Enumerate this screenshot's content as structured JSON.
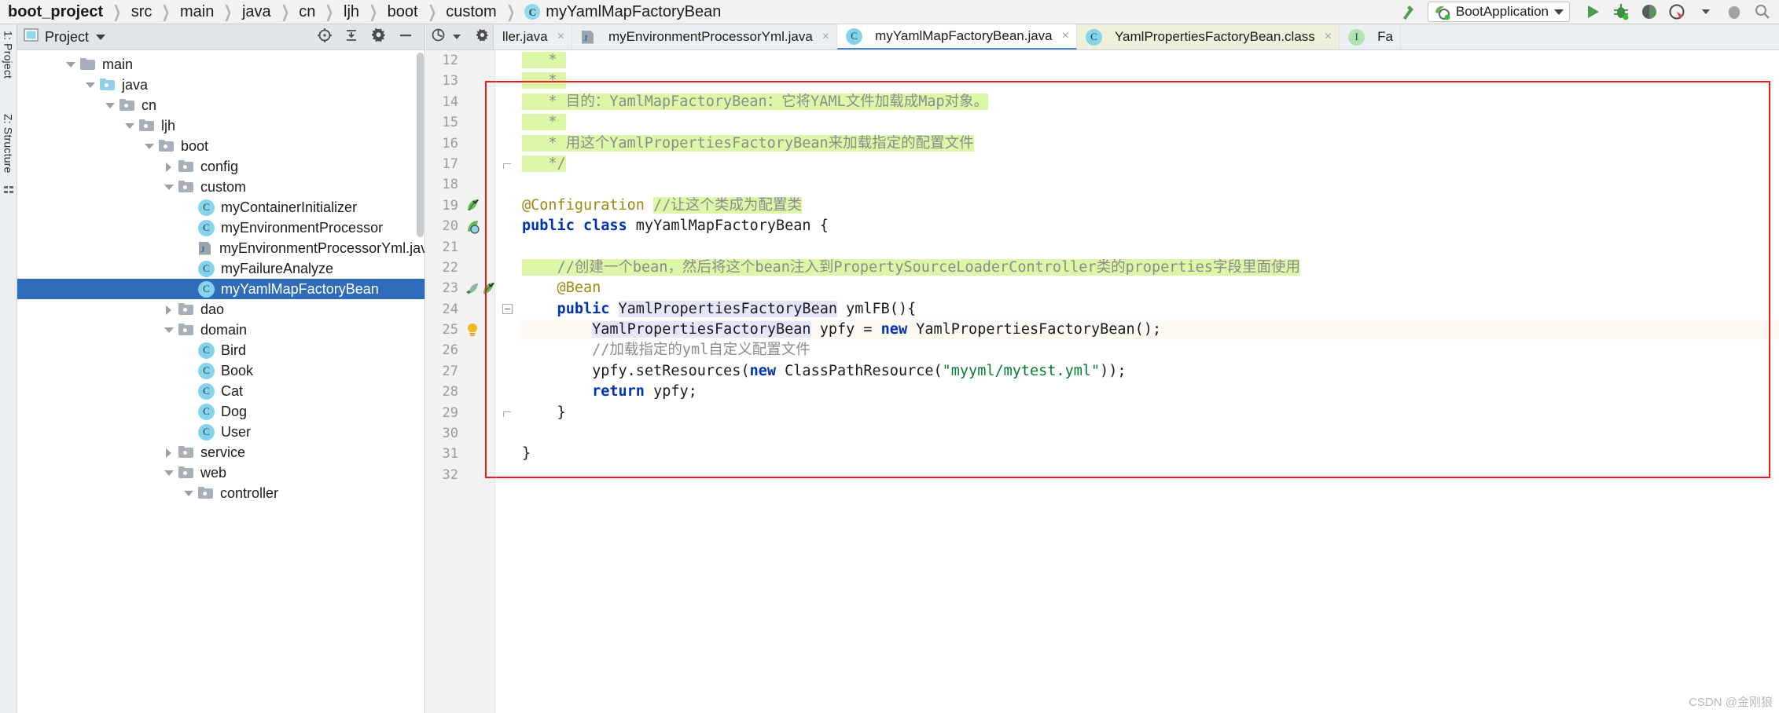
{
  "window": {
    "app": "IntelliJ IDEA",
    "file": "myYamlMapFactoryBean.java"
  },
  "breadcrumb": {
    "items": [
      {
        "label": "boot_project",
        "kind": "project"
      },
      {
        "label": "src",
        "kind": "folder"
      },
      {
        "label": "main",
        "kind": "folder"
      },
      {
        "label": "java",
        "kind": "folder"
      },
      {
        "label": "cn",
        "kind": "package"
      },
      {
        "label": "ljh",
        "kind": "package"
      },
      {
        "label": "boot",
        "kind": "package"
      },
      {
        "label": "custom",
        "kind": "package"
      },
      {
        "label": "myYamlMapFactoryBean",
        "kind": "class",
        "icon": "class-icon",
        "icon_letter": "C"
      }
    ],
    "separator": "❯"
  },
  "toolbar": {
    "build_label": "build-hammer-icon",
    "run_config": {
      "name": "BootApplication",
      "icon": "spring-boot-icon",
      "dropdown": "▼"
    },
    "buttons": [
      {
        "name": "run-button",
        "icon": "play-icon",
        "color": "#4a9a4a"
      },
      {
        "name": "debug-button",
        "icon": "bug-icon",
        "color": "#3e8e41"
      },
      {
        "name": "run-with-coverage-button",
        "icon": "coverage-icon",
        "color": "#3c6b3c"
      },
      {
        "name": "profiler-button",
        "icon": "profiler-icon",
        "color": "#d64c4c"
      },
      {
        "name": "stop-button",
        "icon": "stop-icon",
        "color": "#9a9a9a"
      }
    ]
  },
  "tool_strips": {
    "left": [
      {
        "label": "1: Project",
        "name": "tool-window-project"
      },
      {
        "label": "Z: Structure",
        "name": "tool-window-structure"
      }
    ]
  },
  "project_panel": {
    "title": "Project",
    "dropdown": "▾",
    "header_icons": [
      {
        "name": "locate-file-icon",
        "glyph": "⊕"
      },
      {
        "name": "collapse-all-icon",
        "glyph": "⤓"
      },
      {
        "name": "settings-gear-icon",
        "glyph": "⚙"
      },
      {
        "name": "hide-panel-icon",
        "glyph": "—"
      }
    ],
    "tree": [
      {
        "label": "main",
        "indent": 2,
        "arrow": "down",
        "icon": "folder-icon",
        "selected": false
      },
      {
        "label": "java",
        "indent": 3,
        "arrow": "down",
        "icon": "source-folder-icon",
        "selected": false
      },
      {
        "label": "cn",
        "indent": 4,
        "arrow": "down",
        "icon": "package-icon",
        "selected": false
      },
      {
        "label": "ljh",
        "indent": 5,
        "arrow": "down",
        "icon": "package-icon",
        "selected": false
      },
      {
        "label": "boot",
        "indent": 6,
        "arrow": "down",
        "icon": "package-icon",
        "selected": false
      },
      {
        "label": "config",
        "indent": 7,
        "arrow": "right",
        "icon": "package-icon",
        "selected": false
      },
      {
        "label": "custom",
        "indent": 7,
        "arrow": "down",
        "icon": "package-icon",
        "selected": false
      },
      {
        "label": "myContainerInitializer",
        "indent": 8,
        "arrow": "none",
        "icon": "java-class-icon",
        "selected": false
      },
      {
        "label": "myEnvironmentProcessor",
        "indent": 8,
        "arrow": "none",
        "icon": "java-class-icon",
        "selected": false
      },
      {
        "label": "myEnvironmentProcessorYml.java",
        "indent": 8,
        "arrow": "none",
        "icon": "java-file-icon",
        "selected": false
      },
      {
        "label": "myFailureAnalyze",
        "indent": 8,
        "arrow": "none",
        "icon": "java-class-icon",
        "selected": false
      },
      {
        "label": "myYamlMapFactoryBean",
        "indent": 8,
        "arrow": "none",
        "icon": "java-class-icon",
        "selected": true
      },
      {
        "label": "dao",
        "indent": 7,
        "arrow": "right",
        "icon": "package-icon",
        "selected": false
      },
      {
        "label": "domain",
        "indent": 7,
        "arrow": "down",
        "icon": "package-icon",
        "selected": false
      },
      {
        "label": "Bird",
        "indent": 8,
        "arrow": "none",
        "icon": "java-class-icon",
        "selected": false
      },
      {
        "label": "Book",
        "indent": 8,
        "arrow": "none",
        "icon": "java-class-icon",
        "selected": false
      },
      {
        "label": "Cat",
        "indent": 8,
        "arrow": "none",
        "icon": "java-class-icon",
        "selected": false
      },
      {
        "label": "Dog",
        "indent": 8,
        "arrow": "none",
        "icon": "java-class-icon",
        "selected": false
      },
      {
        "label": "User",
        "indent": 8,
        "arrow": "none",
        "icon": "java-class-icon",
        "selected": false
      },
      {
        "label": "service",
        "indent": 7,
        "arrow": "right",
        "icon": "package-icon",
        "selected": false
      },
      {
        "label": "web",
        "indent": 7,
        "arrow": "down",
        "icon": "package-icon",
        "selected": false
      },
      {
        "label": "controller",
        "indent": 8,
        "arrow": "down",
        "icon": "package-icon",
        "selected": false
      }
    ]
  },
  "editor": {
    "tab_tools": [
      {
        "name": "previous-occurrence-icon",
        "glyph": "ⓛ"
      },
      {
        "name": "collapse-lines-icon",
        "glyph": "↧"
      },
      {
        "name": "tab-settings-icon",
        "glyph": "⚙"
      },
      {
        "name": "hide-editor-icon",
        "glyph": "—"
      }
    ],
    "tabs": [
      {
        "label": "ller.java",
        "icon": "java-class-icon",
        "active": false,
        "kind": "truncated",
        "closable": true
      },
      {
        "label": "myEnvironmentProcessorYml.java",
        "icon": "java-file-icon",
        "active": false,
        "kind": "java",
        "closable": true
      },
      {
        "label": "myYamlMapFactoryBean.java",
        "icon": "java-class-icon",
        "active": true,
        "kind": "java",
        "closable": true
      },
      {
        "label": "YamlPropertiesFactoryBean.class",
        "icon": "java-class-icon",
        "active": false,
        "kind": "class",
        "closable": true
      },
      {
        "label": "Fa",
        "icon": "interface-icon",
        "active": false,
        "kind": "truncated",
        "closable": false
      }
    ],
    "first_line": 12,
    "lines": [
      {
        "n": 12,
        "gutter": [],
        "fold": "none",
        "caret": false,
        "segments": [
          {
            "text": "   * ",
            "cls": "cmt",
            "hl": "green"
          }
        ]
      },
      {
        "n": 13,
        "gutter": [],
        "fold": "none",
        "caret": false,
        "segments": [
          {
            "text": "   * ",
            "cls": "cmt",
            "hl": "green"
          }
        ]
      },
      {
        "n": 14,
        "gutter": [],
        "fold": "none",
        "caret": false,
        "segments": [
          {
            "text": "   * 目的：YamlMapFactoryBean：它将YAML文件加载成Map对象。",
            "cls": "cmt",
            "hl": "green"
          }
        ]
      },
      {
        "n": 15,
        "gutter": [],
        "fold": "none",
        "caret": false,
        "segments": [
          {
            "text": "   * ",
            "cls": "cmt",
            "hl": "green"
          }
        ]
      },
      {
        "n": 16,
        "gutter": [],
        "fold": "none",
        "caret": false,
        "segments": [
          {
            "text": "   * 用这个YamlPropertiesFactoryBean来加载指定的配置文件",
            "cls": "cmt",
            "hl": "green"
          }
        ]
      },
      {
        "n": 17,
        "gutter": [],
        "fold": "end",
        "caret": false,
        "segments": [
          {
            "text": "   */",
            "cls": "cmt",
            "hl": "green"
          }
        ]
      },
      {
        "n": 18,
        "gutter": [],
        "fold": "none",
        "caret": false,
        "segments": [
          {
            "text": " ",
            "cls": "txt",
            "hl": "none"
          }
        ]
      },
      {
        "n": 19,
        "gutter": [
          "spring-bean-leaf-icon"
        ],
        "fold": "none",
        "caret": false,
        "segments": [
          {
            "text": "@Configuration ",
            "cls": "ann",
            "hl": "none"
          },
          {
            "text": "//让这个类成为配置类",
            "cls": "cmt",
            "hl": "green"
          }
        ]
      },
      {
        "n": 20,
        "gutter": [
          "spring-config-bean-icon"
        ],
        "fold": "none",
        "caret": false,
        "segments": [
          {
            "text": "public class ",
            "cls": "kw",
            "hl": "none"
          },
          {
            "text": "myYamlMapFactoryBean {",
            "cls": "txt",
            "hl": "none"
          }
        ]
      },
      {
        "n": 21,
        "gutter": [],
        "fold": "none",
        "caret": false,
        "segments": [
          {
            "text": " ",
            "cls": "txt",
            "hl": "none"
          }
        ]
      },
      {
        "n": 22,
        "gutter": [],
        "fold": "none",
        "caret": false,
        "segments": [
          {
            "text": "    //创建一个bean，然后将这个bean注入到PropertySourceLoaderController类的properties字段里面使用",
            "cls": "cmt",
            "hl": "green"
          }
        ]
      },
      {
        "n": 23,
        "gutter": [
          "bean-navigate-icon",
          "spring-bean-leaf-icon"
        ],
        "fold": "none",
        "caret": false,
        "segments": [
          {
            "text": "    @Bean",
            "cls": "ann",
            "hl": "none"
          }
        ]
      },
      {
        "n": 24,
        "gutter": [],
        "fold": "box",
        "caret": false,
        "segments": [
          {
            "text": "    public ",
            "cls": "kw",
            "hl": "none"
          },
          {
            "text": "YamlPropertiesFactoryBean",
            "cls": "txt",
            "hl": "lav"
          },
          {
            "text": " ymlFB(){",
            "cls": "txt",
            "hl": "none"
          }
        ]
      },
      {
        "n": 25,
        "gutter": [
          "intention-bulb-icon"
        ],
        "fold": "none",
        "caret": true,
        "segments": [
          {
            "text": "        ",
            "cls": "txt",
            "hl": "none"
          },
          {
            "text": "YamlPropertiesFactoryBean",
            "cls": "txt",
            "hl": "lav"
          },
          {
            "text": " ypfy = ",
            "cls": "txt",
            "hl": "none"
          },
          {
            "text": "new ",
            "cls": "kw",
            "hl": "none"
          },
          {
            "text": "YamlPropertiesFactoryBean();",
            "cls": "txt",
            "hl": "none"
          }
        ]
      },
      {
        "n": 26,
        "gutter": [],
        "fold": "none",
        "caret": false,
        "segments": [
          {
            "text": "        //加载指定的yml自定义配置文件",
            "cls": "cmt",
            "hl": "none"
          }
        ]
      },
      {
        "n": 27,
        "gutter": [],
        "fold": "none",
        "caret": false,
        "segments": [
          {
            "text": "        ypfy.setResources(",
            "cls": "txt",
            "hl": "none"
          },
          {
            "text": "new ",
            "cls": "kw",
            "hl": "none"
          },
          {
            "text": "ClassPathResource(",
            "cls": "txt",
            "hl": "none"
          },
          {
            "text": "\"myyml/mytest.yml\"",
            "cls": "str",
            "hl": "none"
          },
          {
            "text": "));",
            "cls": "txt",
            "hl": "none"
          }
        ]
      },
      {
        "n": 28,
        "gutter": [],
        "fold": "none",
        "caret": false,
        "segments": [
          {
            "text": "        return ",
            "cls": "kw",
            "hl": "none"
          },
          {
            "text": "ypfy;",
            "cls": "txt",
            "hl": "none"
          }
        ]
      },
      {
        "n": 29,
        "gutter": [],
        "fold": "end",
        "caret": false,
        "segments": [
          {
            "text": "    }",
            "cls": "txt",
            "hl": "none"
          }
        ]
      },
      {
        "n": 30,
        "gutter": [],
        "fold": "none",
        "caret": false,
        "segments": [
          {
            "text": " ",
            "cls": "txt",
            "hl": "none"
          }
        ]
      },
      {
        "n": 31,
        "gutter": [],
        "fold": "none",
        "caret": false,
        "segments": [
          {
            "text": "}",
            "cls": "txt",
            "hl": "none"
          }
        ]
      },
      {
        "n": 32,
        "gutter": [],
        "fold": "none",
        "caret": false,
        "segments": [
          {
            "text": " ",
            "cls": "txt",
            "hl": "none"
          }
        ]
      }
    ],
    "annotation_box": {
      "name": "red-highlight-rectangle",
      "color": "#e81e24"
    }
  },
  "watermark": {
    "text": "CSDN @金刚狼"
  },
  "colors": {
    "selection_blue": "#2f6dbb",
    "comment_highlight_green": "#dcf7a8",
    "lavender_highlight": "#e6e6fa",
    "caret_line": "#fcfaf2",
    "annotation_red": "#e81e24",
    "keyword_blue": "#0033b3",
    "annotation_gold": "#9e880d",
    "string_green": "#057d31"
  }
}
